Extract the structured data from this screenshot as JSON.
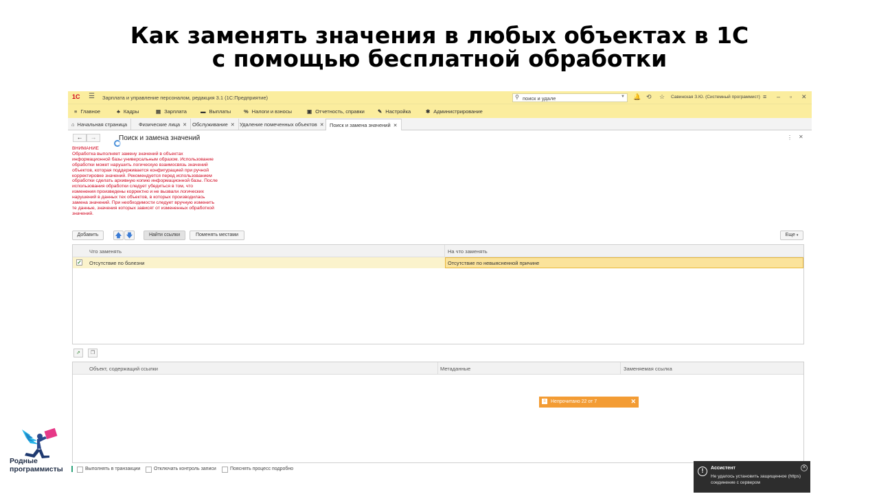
{
  "headline": {
    "line1": "Как заменять значения в любых объектах в 1С",
    "line2": "с помощью бесплатной обработки"
  },
  "app": {
    "title": "Зарплата и управление персоналом, редакция 3.1  (1С:Предприятие)",
    "search_value": "поиск и удале",
    "user": "Савинская З.Ю. (Системный программист)"
  },
  "menu": [
    {
      "icon": "≡",
      "label": "Главное"
    },
    {
      "icon": "♣",
      "label": "Кадры"
    },
    {
      "icon": "▤",
      "label": "Зарплата"
    },
    {
      "icon": "▬",
      "label": "Выплаты"
    },
    {
      "icon": "%",
      "label": "Налоги и взносы"
    },
    {
      "icon": "▣",
      "label": "Отчетность, справки"
    },
    {
      "icon": "✎",
      "label": "Настройка"
    },
    {
      "icon": "✱",
      "label": "Администрирование"
    }
  ],
  "tabs": [
    {
      "label": "Начальная страница"
    },
    {
      "label": "Физические лица"
    },
    {
      "label": "Обслуживание"
    },
    {
      "label": "Удаление помеченных объектов"
    },
    {
      "label": "Поиск и замена значений"
    }
  ],
  "form": {
    "title": "Поиск и замена значений",
    "warning_title": "ВНИМАНИЕ",
    "warning_lines": [
      "Обработка выполняет замену значений в объектах",
      "информационной базы универсальным образом.  Использование",
      "обработки может нарушить логическую взаимосвязь значений",
      "объектов, которая поддерживается конфигурацией при ручной",
      "корректировке значений. Рекомендуется перед использованием",
      "обработки сделать архивную копию информационной базы. После",
      "использования обработки следует убедиться в том, что",
      "изменения произведены корректно и не вызвали логических",
      "нарушений в данных тех объектов, в которых производилась",
      "замена значений. При необходимости следует вручную изменить",
      "те данные, значения которых зависят от измененных обработкой",
      "значений."
    ],
    "buttons": {
      "add": "Добавить",
      "up": "🡅",
      "down": "🡇",
      "find": "Найти ссылки",
      "swap": "Поменять местами",
      "more": "Еще"
    }
  },
  "replace_table": {
    "col1": "Что заменять",
    "col2": "На что заменять",
    "rows": [
      {
        "checked": true,
        "what": "Отсутствие по болезни",
        "with": "Отсутствие по невыясненной причине"
      }
    ]
  },
  "refs_table": {
    "col1": "Объект, содержащий ссылки",
    "col2": "Метаданные",
    "col3": "Заменяемая ссылка"
  },
  "toast": {
    "text": "Непрочитано 22 от 7"
  },
  "options": [
    {
      "label": "Выполнять в транзакции"
    },
    {
      "label": "Отключать контроль записи"
    },
    {
      "label": "Пояснять процесс подробно"
    }
  ],
  "assistant": {
    "title": "Ассистент",
    "message": "Не удалось установить защищенное (https) соединение с сервером"
  },
  "brand": {
    "line1": "Родные",
    "line2": "программисты"
  },
  "colors": {
    "header_bg": "#fbed9e",
    "warning": "#d0021b",
    "toast": "#f39c34",
    "selected_cell": "#fbe39b",
    "assistant_bg": "#2d2d2d"
  }
}
